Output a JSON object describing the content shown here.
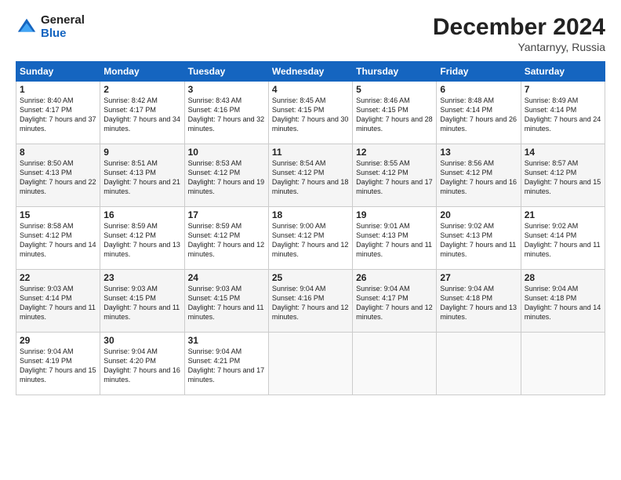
{
  "logo": {
    "general": "General",
    "blue": "Blue"
  },
  "calendar": {
    "title": "December 2024",
    "subtitle": "Yantarnyy, Russia",
    "days": [
      "Sunday",
      "Monday",
      "Tuesday",
      "Wednesday",
      "Thursday",
      "Friday",
      "Saturday"
    ],
    "weeks": [
      [
        {
          "day": "1",
          "sunrise": "Sunrise: 8:40 AM",
          "sunset": "Sunset: 4:17 PM",
          "daylight": "Daylight: 7 hours and 37 minutes."
        },
        {
          "day": "2",
          "sunrise": "Sunrise: 8:42 AM",
          "sunset": "Sunset: 4:17 PM",
          "daylight": "Daylight: 7 hours and 34 minutes."
        },
        {
          "day": "3",
          "sunrise": "Sunrise: 8:43 AM",
          "sunset": "Sunset: 4:16 PM",
          "daylight": "Daylight: 7 hours and 32 minutes."
        },
        {
          "day": "4",
          "sunrise": "Sunrise: 8:45 AM",
          "sunset": "Sunset: 4:15 PM",
          "daylight": "Daylight: 7 hours and 30 minutes."
        },
        {
          "day": "5",
          "sunrise": "Sunrise: 8:46 AM",
          "sunset": "Sunset: 4:15 PM",
          "daylight": "Daylight: 7 hours and 28 minutes."
        },
        {
          "day": "6",
          "sunrise": "Sunrise: 8:48 AM",
          "sunset": "Sunset: 4:14 PM",
          "daylight": "Daylight: 7 hours and 26 minutes."
        },
        {
          "day": "7",
          "sunrise": "Sunrise: 8:49 AM",
          "sunset": "Sunset: 4:14 PM",
          "daylight": "Daylight: 7 hours and 24 minutes."
        }
      ],
      [
        {
          "day": "8",
          "sunrise": "Sunrise: 8:50 AM",
          "sunset": "Sunset: 4:13 PM",
          "daylight": "Daylight: 7 hours and 22 minutes."
        },
        {
          "day": "9",
          "sunrise": "Sunrise: 8:51 AM",
          "sunset": "Sunset: 4:13 PM",
          "daylight": "Daylight: 7 hours and 21 minutes."
        },
        {
          "day": "10",
          "sunrise": "Sunrise: 8:53 AM",
          "sunset": "Sunset: 4:12 PM",
          "daylight": "Daylight: 7 hours and 19 minutes."
        },
        {
          "day": "11",
          "sunrise": "Sunrise: 8:54 AM",
          "sunset": "Sunset: 4:12 PM",
          "daylight": "Daylight: 7 hours and 18 minutes."
        },
        {
          "day": "12",
          "sunrise": "Sunrise: 8:55 AM",
          "sunset": "Sunset: 4:12 PM",
          "daylight": "Daylight: 7 hours and 17 minutes."
        },
        {
          "day": "13",
          "sunrise": "Sunrise: 8:56 AM",
          "sunset": "Sunset: 4:12 PM",
          "daylight": "Daylight: 7 hours and 16 minutes."
        },
        {
          "day": "14",
          "sunrise": "Sunrise: 8:57 AM",
          "sunset": "Sunset: 4:12 PM",
          "daylight": "Daylight: 7 hours and 15 minutes."
        }
      ],
      [
        {
          "day": "15",
          "sunrise": "Sunrise: 8:58 AM",
          "sunset": "Sunset: 4:12 PM",
          "daylight": "Daylight: 7 hours and 14 minutes."
        },
        {
          "day": "16",
          "sunrise": "Sunrise: 8:59 AM",
          "sunset": "Sunset: 4:12 PM",
          "daylight": "Daylight: 7 hours and 13 minutes."
        },
        {
          "day": "17",
          "sunrise": "Sunrise: 8:59 AM",
          "sunset": "Sunset: 4:12 PM",
          "daylight": "Daylight: 7 hours and 12 minutes."
        },
        {
          "day": "18",
          "sunrise": "Sunrise: 9:00 AM",
          "sunset": "Sunset: 4:12 PM",
          "daylight": "Daylight: 7 hours and 12 minutes."
        },
        {
          "day": "19",
          "sunrise": "Sunrise: 9:01 AM",
          "sunset": "Sunset: 4:13 PM",
          "daylight": "Daylight: 7 hours and 11 minutes."
        },
        {
          "day": "20",
          "sunrise": "Sunrise: 9:02 AM",
          "sunset": "Sunset: 4:13 PM",
          "daylight": "Daylight: 7 hours and 11 minutes."
        },
        {
          "day": "21",
          "sunrise": "Sunrise: 9:02 AM",
          "sunset": "Sunset: 4:14 PM",
          "daylight": "Daylight: 7 hours and 11 minutes."
        }
      ],
      [
        {
          "day": "22",
          "sunrise": "Sunrise: 9:03 AM",
          "sunset": "Sunset: 4:14 PM",
          "daylight": "Daylight: 7 hours and 11 minutes."
        },
        {
          "day": "23",
          "sunrise": "Sunrise: 9:03 AM",
          "sunset": "Sunset: 4:15 PM",
          "daylight": "Daylight: 7 hours and 11 minutes."
        },
        {
          "day": "24",
          "sunrise": "Sunrise: 9:03 AM",
          "sunset": "Sunset: 4:15 PM",
          "daylight": "Daylight: 7 hours and 11 minutes."
        },
        {
          "day": "25",
          "sunrise": "Sunrise: 9:04 AM",
          "sunset": "Sunset: 4:16 PM",
          "daylight": "Daylight: 7 hours and 12 minutes."
        },
        {
          "day": "26",
          "sunrise": "Sunrise: 9:04 AM",
          "sunset": "Sunset: 4:17 PM",
          "daylight": "Daylight: 7 hours and 12 minutes."
        },
        {
          "day": "27",
          "sunrise": "Sunrise: 9:04 AM",
          "sunset": "Sunset: 4:18 PM",
          "daylight": "Daylight: 7 hours and 13 minutes."
        },
        {
          "day": "28",
          "sunrise": "Sunrise: 9:04 AM",
          "sunset": "Sunset: 4:18 PM",
          "daylight": "Daylight: 7 hours and 14 minutes."
        }
      ],
      [
        {
          "day": "29",
          "sunrise": "Sunrise: 9:04 AM",
          "sunset": "Sunset: 4:19 PM",
          "daylight": "Daylight: 7 hours and 15 minutes."
        },
        {
          "day": "30",
          "sunrise": "Sunrise: 9:04 AM",
          "sunset": "Sunset: 4:20 PM",
          "daylight": "Daylight: 7 hours and 16 minutes."
        },
        {
          "day": "31",
          "sunrise": "Sunrise: 9:04 AM",
          "sunset": "Sunset: 4:21 PM",
          "daylight": "Daylight: 7 hours and 17 minutes."
        },
        null,
        null,
        null,
        null
      ]
    ]
  }
}
